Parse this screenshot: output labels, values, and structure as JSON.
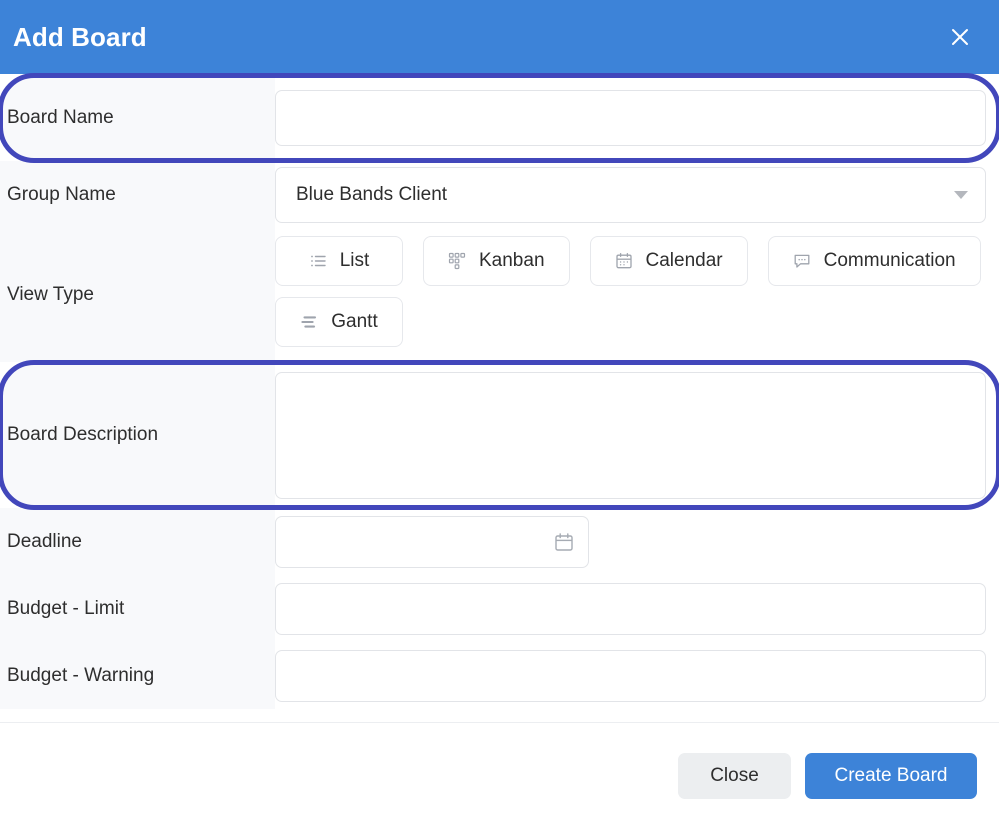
{
  "header": {
    "title": "Add Board",
    "close_icon": "close-icon"
  },
  "form": {
    "board_name": {
      "label": "Board Name",
      "value": "",
      "placeholder": ""
    },
    "group_name": {
      "label": "Group Name",
      "value": "Blue Bands Client",
      "caret_icon": "chevron-down-icon"
    },
    "view_type": {
      "label": "View Type",
      "options": [
        {
          "label": "List",
          "icon": "list-icon"
        },
        {
          "label": "Kanban",
          "icon": "kanban-grid-icon"
        },
        {
          "label": "Calendar",
          "icon": "calendar-icon"
        },
        {
          "label": "Communication",
          "icon": "chat-bubble-icon"
        },
        {
          "label": "Gantt",
          "icon": "gantt-bars-icon"
        }
      ]
    },
    "board_description": {
      "label": "Board Description",
      "value": "",
      "placeholder": ""
    },
    "deadline": {
      "label": "Deadline",
      "value": "",
      "placeholder": "",
      "icon": "calendar-picker-icon"
    },
    "budget_limit": {
      "label": "Budget - Limit",
      "value": "",
      "placeholder": ""
    },
    "budget_warning": {
      "label": "Budget - Warning",
      "value": "",
      "placeholder": ""
    }
  },
  "footer": {
    "close_label": "Close",
    "create_label": "Create Board"
  },
  "colors": {
    "header_blue": "#3d83d8",
    "primary_button": "#3d83d8",
    "highlight_ring": "#4247bb",
    "label_column": "#f8f9fb",
    "border": "#e2e4e8"
  }
}
